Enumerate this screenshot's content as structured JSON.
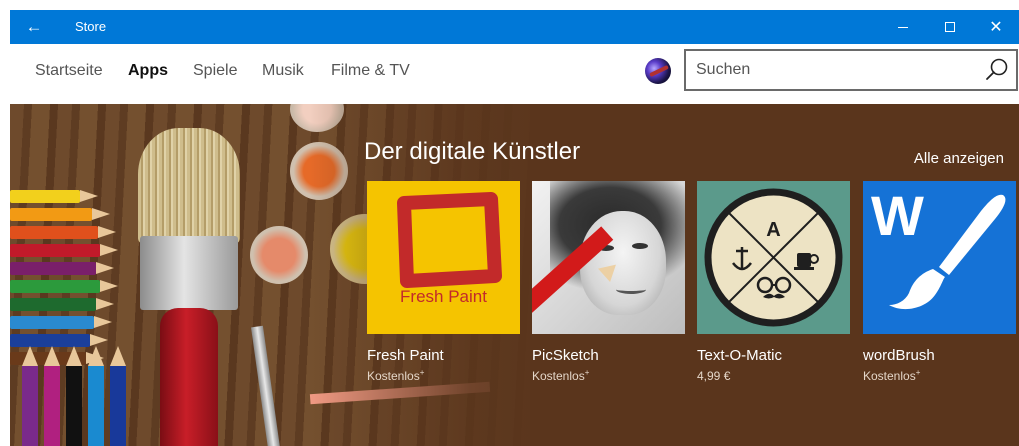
{
  "window": {
    "title": "Store"
  },
  "nav": {
    "items": [
      {
        "label": "Startseite",
        "active": false
      },
      {
        "label": "Apps",
        "active": true
      },
      {
        "label": "Spiele",
        "active": false
      },
      {
        "label": "Musik",
        "active": false
      },
      {
        "label": "Filme & TV",
        "active": false
      }
    ]
  },
  "search": {
    "placeholder": "Suchen",
    "value": ""
  },
  "hero": {
    "title": "Der digitale Künstler",
    "see_all": "Alle anzeigen",
    "apps": [
      {
        "name": "Fresh Paint",
        "price": "Kostenlos",
        "price_mark": "+",
        "icon": "fresh-paint-logo",
        "logo_text": "Fresh Paint",
        "tile_color": "#f5c400"
      },
      {
        "name": "PicSketch",
        "price": "Kostenlos",
        "price_mark": "+",
        "icon": "pencil-portrait-sketch",
        "tile_color": "#dcdcdc"
      },
      {
        "name": "Text-O-Matic",
        "price": "4,99 €",
        "price_mark": "",
        "icon": "badge-emblem",
        "badge_letter": "A",
        "tile_color": "#5b9a8b"
      },
      {
        "name": "wordBrush",
        "price": "Kostenlos",
        "price_mark": "+",
        "icon": "brush-w-logo",
        "logo_letter": "W",
        "tile_color": "#1572d6"
      }
    ]
  },
  "colors": {
    "titlebar": "#0078d7",
    "hero_bg": "#5a351c",
    "accent": "#0078d7"
  }
}
